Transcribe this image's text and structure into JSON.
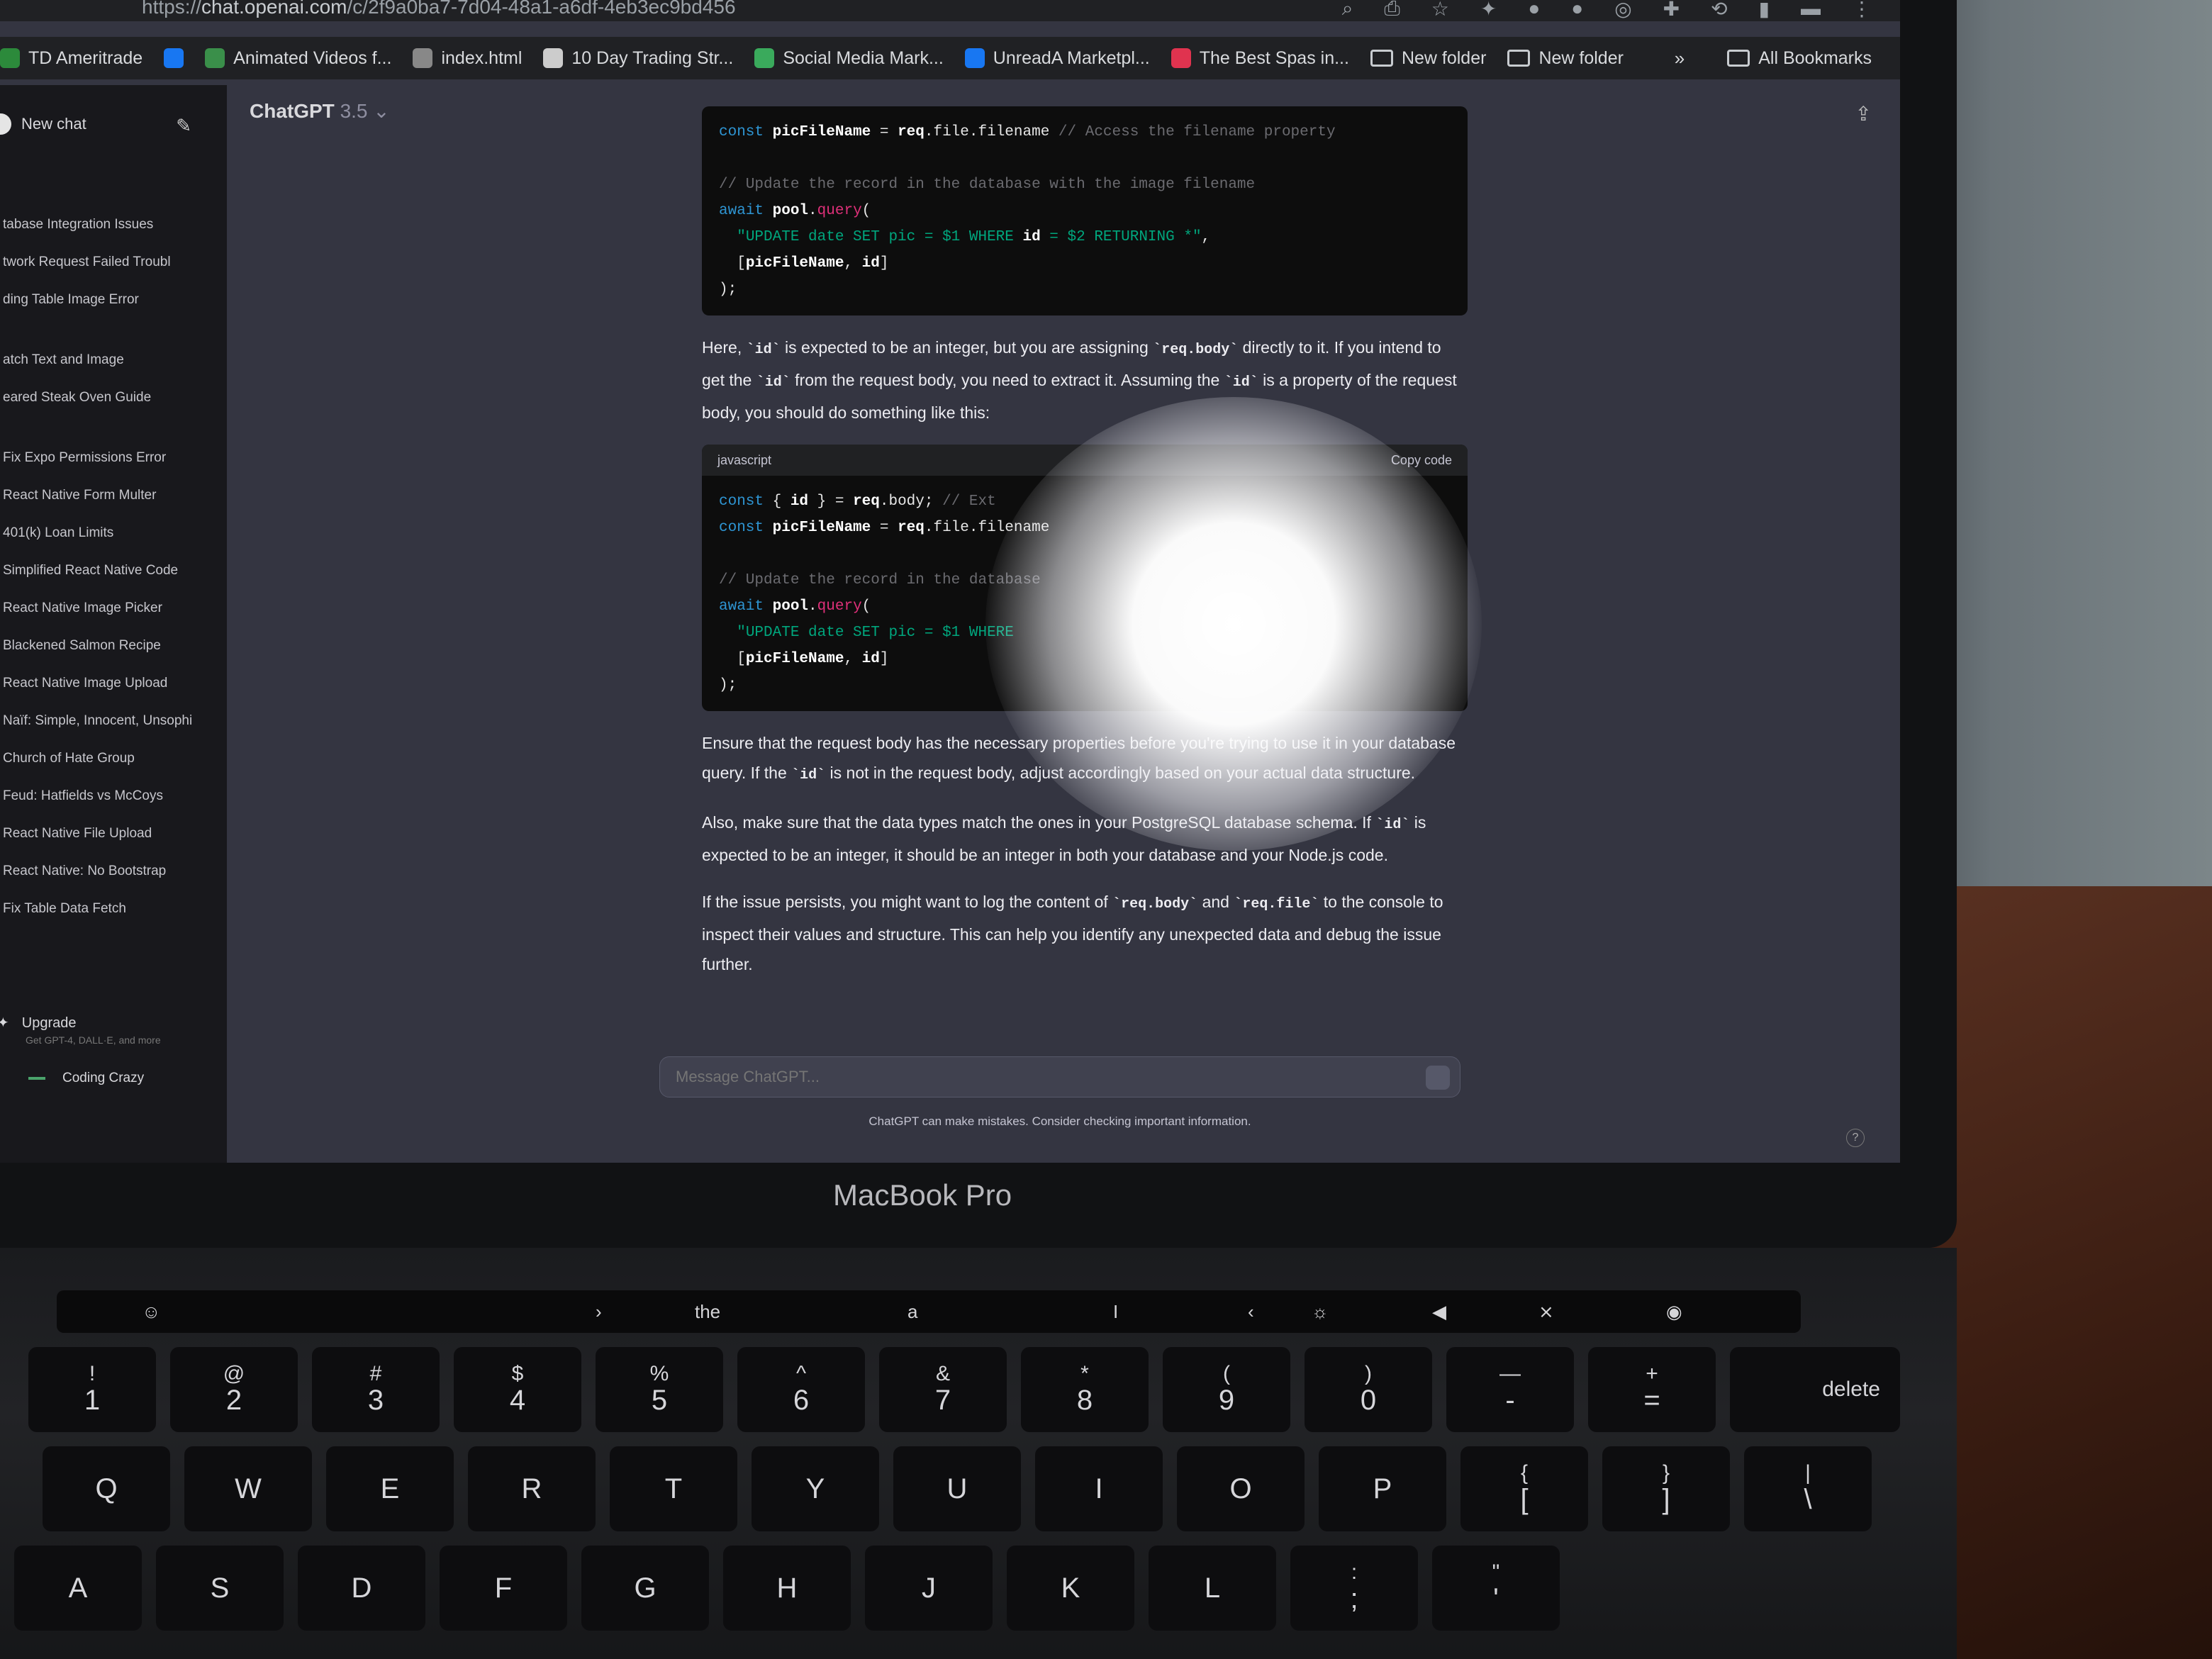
{
  "browser": {
    "url_host": "chat.openai.com",
    "url_path": "/c/2f9a0ba7-7d04-48a1-a6df-4eb3ec9bd456",
    "bookmarks": [
      {
        "label": "TD Ameritrade",
        "color": "#2c8a3b"
      },
      {
        "label": "",
        "color": "#1877f2"
      },
      {
        "label": "Animated Videos f...",
        "color": "#3a8f4a"
      },
      {
        "label": "index.html",
        "color": "#888888"
      },
      {
        "label": "10 Day Trading Str...",
        "color": "#cccccc"
      },
      {
        "label": "Social Media Mark...",
        "color": "#3aaa5c"
      },
      {
        "label": "UnreadA Marketpl...",
        "color": "#1877f2"
      },
      {
        "label": "The Best Spas in...",
        "color": "#e0334f"
      },
      {
        "label": "New folder",
        "color": "folder"
      },
      {
        "label": "New folder",
        "color": "folder"
      }
    ],
    "bookmarks_more": "»",
    "all_bookmarks": "All Bookmarks"
  },
  "sidebar": {
    "new_chat": "New chat",
    "groups": [
      [
        "tabase Integration Issues",
        "twork Request Failed Troubl",
        "ding Table Image Error"
      ],
      [
        "atch Text and Image",
        "eared Steak Oven Guide"
      ],
      [
        "Fix Expo Permissions Error",
        "React Native Form Multer",
        "401(k) Loan Limits",
        "Simplified React Native Code",
        "React Native Image Picker",
        "Blackened Salmon Recipe",
        "React Native Image Upload",
        "Naïf: Simple, Innocent, Unsophi",
        "Church of Hate Group",
        "Feud: Hatfields vs McCoys",
        "React Native File Upload",
        "React Native: No Bootstrap",
        "Fix Table Data Fetch"
      ]
    ],
    "upgrade": "Upgrade",
    "upgrade_sub": "Get GPT-4, DALL·E, and more",
    "user": "Coding Crazy"
  },
  "header": {
    "model": "ChatGPT",
    "version": "3.5"
  },
  "code1": {
    "lines": [
      "const picFileName = req.file.filename // Access the filename property",
      "",
      "// Update the record in the database with the image filename",
      "await pool.query(",
      "  \"UPDATE date SET pic = $1 WHERE id = $2 RETURNING *\",",
      "  [picFileName, id]",
      ");"
    ]
  },
  "para1": "Here, `id` is expected to be an integer, but you are assigning `req.body` directly to it. If you intend to get the `id` from the request body, you need to extract it. Assuming the `id` is a property of the request body, you should do something like this:",
  "code2": {
    "lang": "javascript",
    "copy": "Copy code",
    "lines": [
      "const { id } = req.body; // Ext",
      "const picFileName = req.file.filename",
      "",
      "// Update the record in the database",
      "await pool.query(",
      "  \"UPDATE date SET pic = $1 WHERE",
      "  [picFileName, id]",
      ");"
    ]
  },
  "para2": "Ensure that the request body has the necessary properties before you're trying to use it in your database query. If the `id` is not in the request body, adjust accordingly based on your actual data structure.",
  "para3": "Also, make sure that the data types match the ones in your PostgreSQL database schema. If `id` is expected to be an integer, it should be an integer in both your database and your Node.js code.",
  "para4": "If the issue persists, you might want to log the content of `req.body` and `req.file` to the console to inspect their values and structure. This can help you identify any unexpected data and debug the issue further.",
  "composer": {
    "placeholder": "Message ChatGPT..."
  },
  "disclaimer": "ChatGPT can make mistakes. Consider checking important information.",
  "help": "?",
  "device_brand": "MacBook Pro",
  "touchbar": [
    "the",
    "a",
    "I"
  ],
  "keyboard": {
    "row1": [
      [
        "!",
        "1"
      ],
      [
        "@",
        "2"
      ],
      [
        "#",
        "3"
      ],
      [
        "$",
        "4"
      ],
      [
        "%",
        "5"
      ],
      [
        "^",
        "6"
      ],
      [
        "&",
        "7"
      ],
      [
        "*",
        "8"
      ],
      [
        "(",
        "9"
      ],
      [
        ")",
        "0"
      ],
      [
        "—",
        "-"
      ],
      [
        "+",
        "="
      ]
    ],
    "delete": "delete",
    "row2": [
      "Q",
      "W",
      "E",
      "R",
      "T",
      "Y",
      "U",
      "I",
      "O",
      "P",
      [
        "{",
        "["
      ],
      [
        "}",
        "]"
      ],
      [
        "|",
        "\\"
      ]
    ],
    "row3": [
      "A",
      "S",
      "D",
      "F",
      "G",
      "H",
      "J",
      "K",
      "L",
      [
        ":",
        ";"
      ],
      [
        "\"",
        "'"
      ]
    ]
  }
}
